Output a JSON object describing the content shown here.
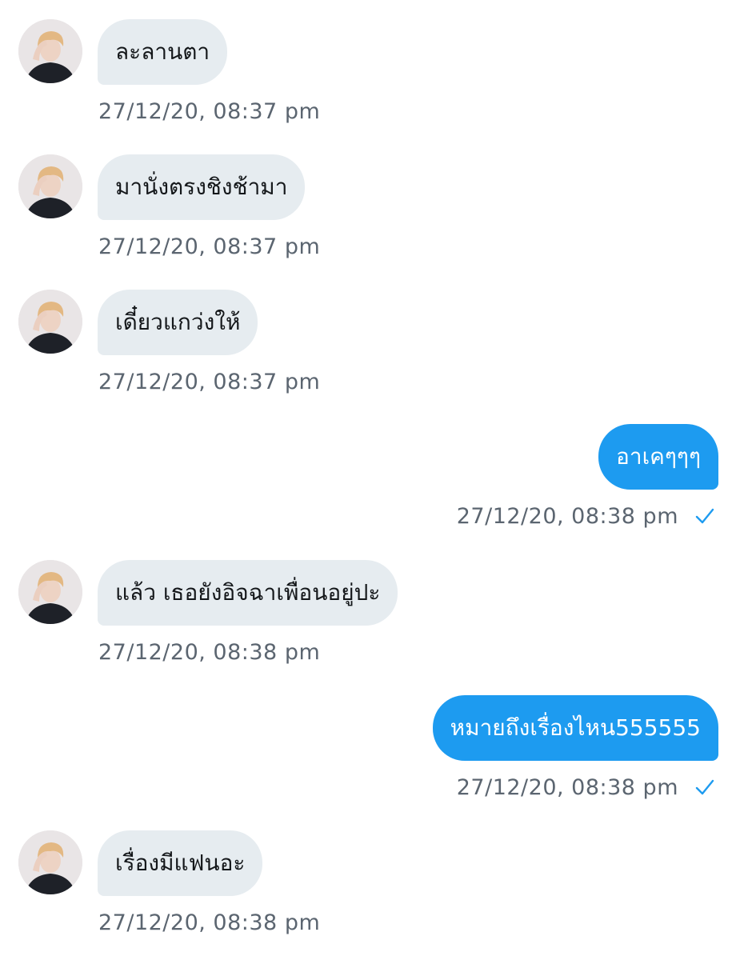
{
  "messages": [
    {
      "side": "in",
      "text": "ละลานตา",
      "time": "27/12/20, 08:37 pm"
    },
    {
      "side": "in",
      "text": "มานั่งตรงชิงช้ามา",
      "time": "27/12/20, 08:37 pm"
    },
    {
      "side": "in",
      "text": "เดี๋ยวแกว่งให้",
      "time": "27/12/20, 08:37 pm"
    },
    {
      "side": "out",
      "text": "อาเคๆๆๆ",
      "time": "27/12/20, 08:38 pm",
      "status_icon": "check-icon"
    },
    {
      "side": "in",
      "text": "แล้ว เธอยังอิจฉาเพื่อนอยู่ปะ",
      "time": "27/12/20, 08:38 pm"
    },
    {
      "side": "out",
      "text": "หมายถึงเรื่องไหน555555",
      "time": "27/12/20, 08:38 pm",
      "status_icon": "check-icon"
    },
    {
      "side": "in",
      "text": "เรื่องมีแฟนอะ",
      "time": "27/12/20, 08:38 pm"
    }
  ],
  "colors": {
    "incoming_bubble": "#e6ecf0",
    "outgoing_bubble": "#1d9bf0",
    "timestamp": "#5b6570",
    "check": "#1d9bf0"
  }
}
